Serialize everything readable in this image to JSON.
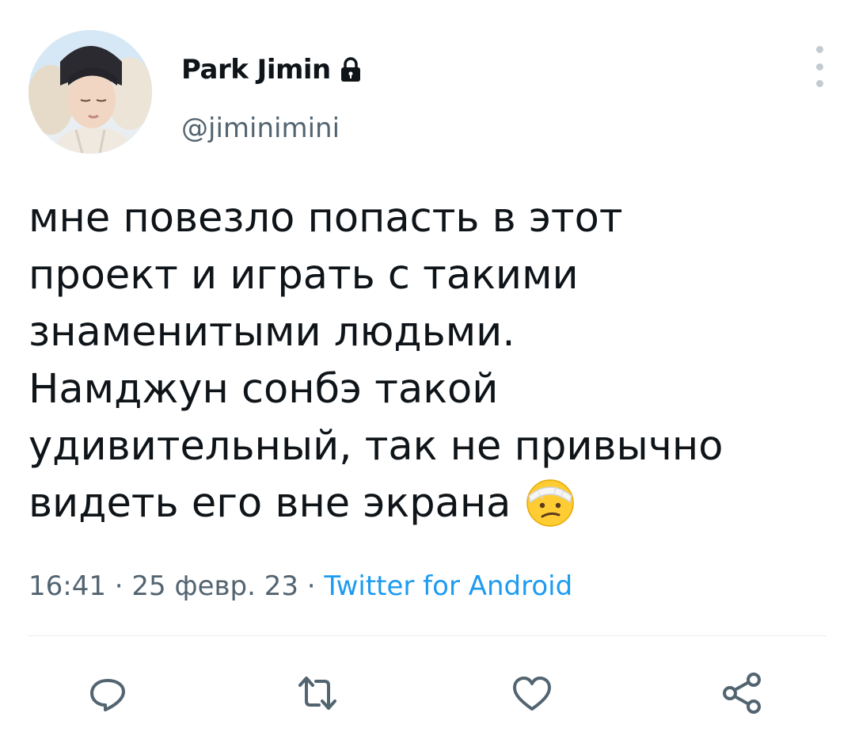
{
  "user": {
    "display_name": "Park Jimin",
    "handle": "@jiminimini",
    "avatar_icon": "profile-photo",
    "protected_icon": "lock-icon"
  },
  "tweet": {
    "text": "мне повезло попасть в этот\nпроект и играть с такими\nзнаменитыми людьми.\nНамджун сонбэ такой\nудивительный, так не привычно\nвидеть его вне экрана",
    "emoji": "face-with-head-bandage-emoji"
  },
  "meta": {
    "time": "16:41",
    "separator": "·",
    "date": "25 февр. 23",
    "source": "Twitter for Android"
  },
  "actions": {
    "reply_icon": "reply-icon",
    "retweet_icon": "retweet-icon",
    "like_icon": "heart-icon",
    "share_icon": "share-icon"
  },
  "colors": {
    "text": "#0f1419",
    "secondary": "#536471",
    "accent": "#1d9bf0",
    "divider": "#e6ecf0",
    "icon": "#536471"
  }
}
